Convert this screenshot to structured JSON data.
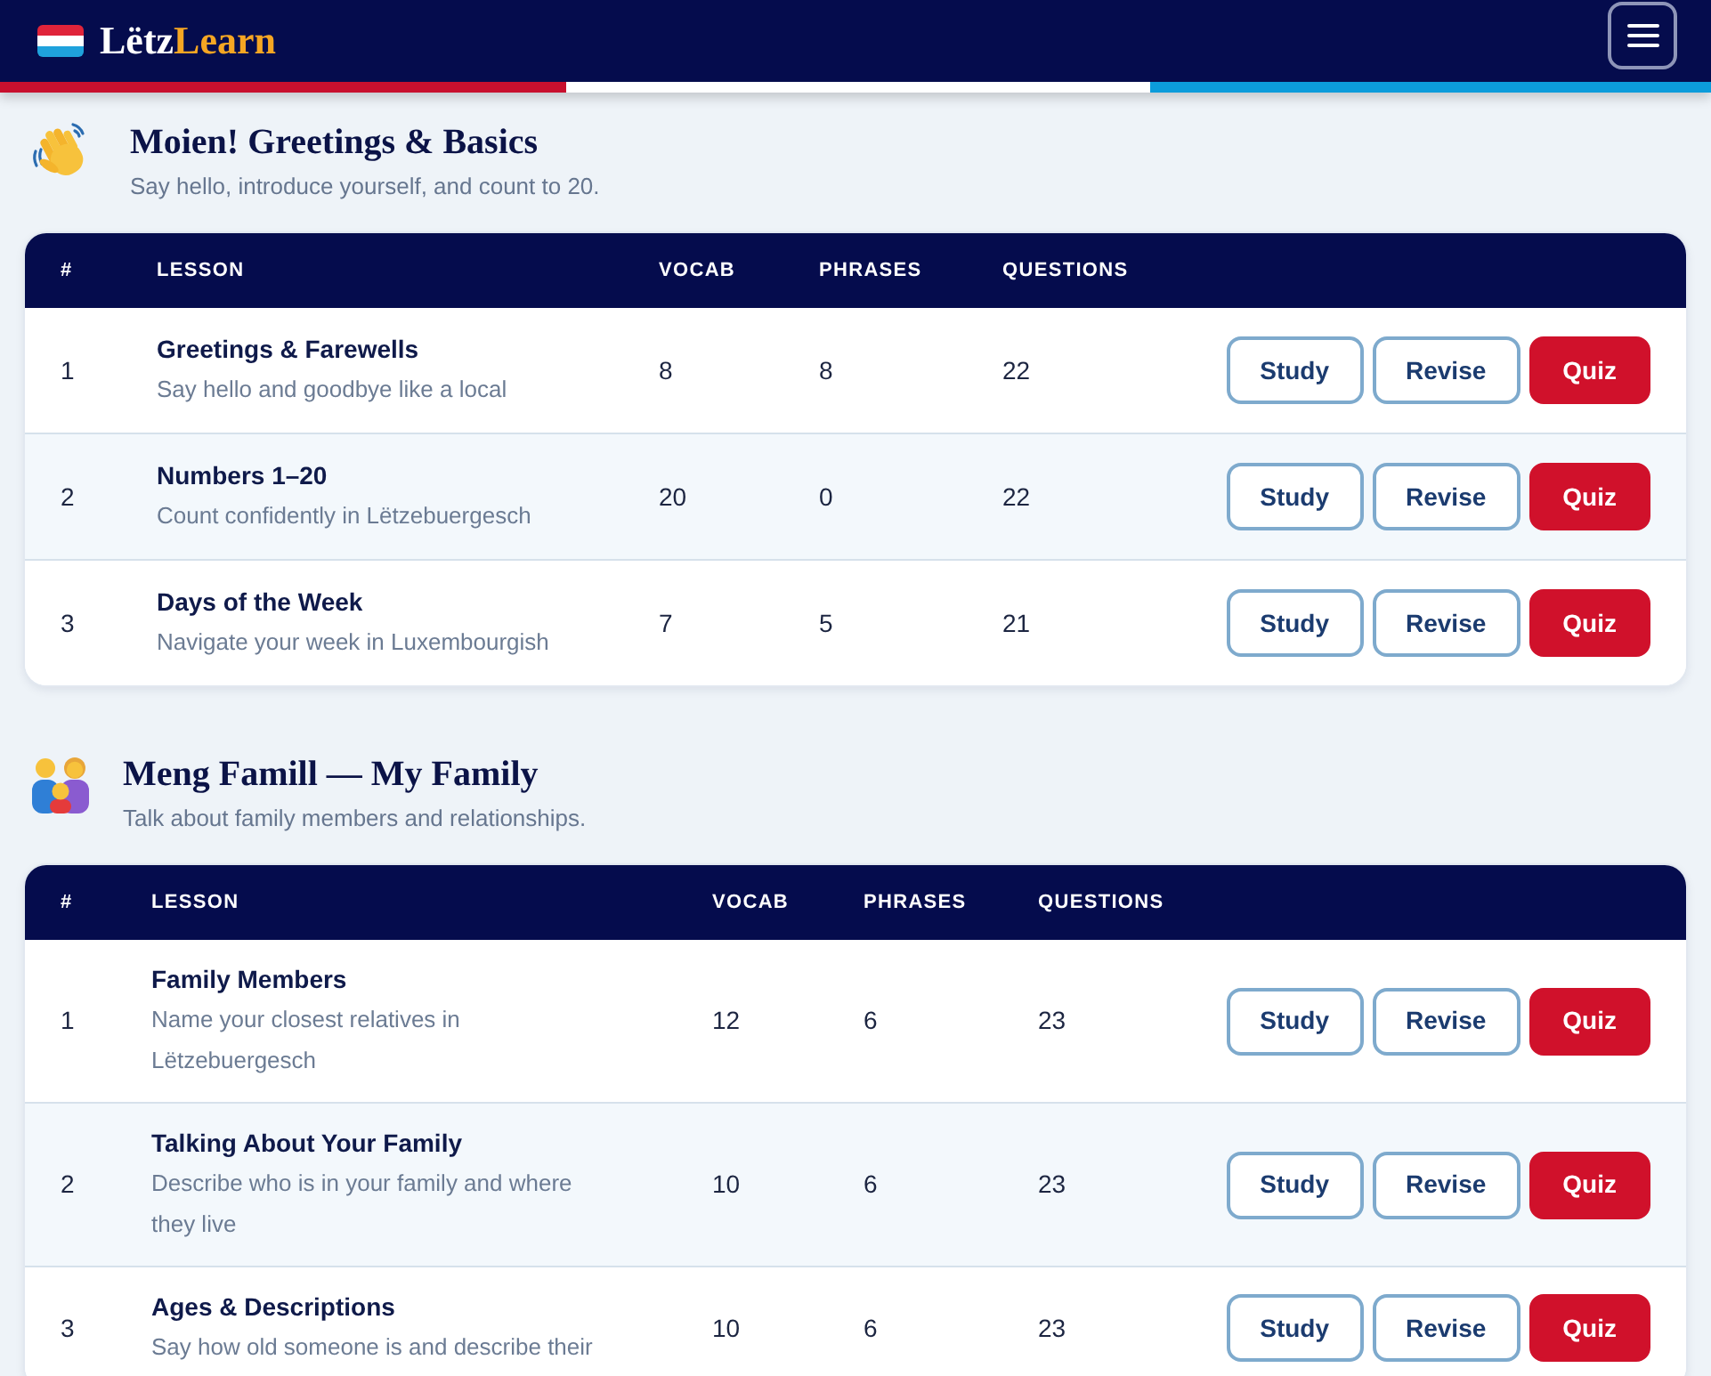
{
  "header": {
    "brand": {
      "text": "Lëtz",
      "accent": "Learn"
    }
  },
  "sections": [
    {
      "title": "Moien! Greetings & Basics",
      "subtitle": "Say hello, introduce yourself, and count to 20.",
      "columns": [
        "#",
        "LESSON",
        "VOCAB",
        "PHRASES",
        "QUESTIONS"
      ],
      "lessons": [
        {
          "number": "1",
          "title": "Greetings & Farewells",
          "description": "Say hello and goodbye like a local",
          "vocab": "8",
          "phrases": "8",
          "questions": "22",
          "actions": [
            {
              "label": "Study",
              "kind": "outline"
            },
            {
              "label": "Revise",
              "kind": "outline"
            },
            {
              "label": "Quiz",
              "kind": "primary"
            }
          ]
        },
        {
          "number": "2",
          "title": "Numbers 1–20",
          "description": "Count confidently in Lëtzebuergesch",
          "vocab": "20",
          "phrases": "0",
          "questions": "22",
          "actions": [
            {
              "label": "Study",
              "kind": "outline"
            },
            {
              "label": "Revise",
              "kind": "outline"
            },
            {
              "label": "Quiz",
              "kind": "primary"
            }
          ]
        },
        {
          "number": "3",
          "title": "Days of the Week",
          "description": "Navigate your week in Luxembourgish",
          "vocab": "7",
          "phrases": "5",
          "questions": "21",
          "actions": [
            {
              "label": "Study",
              "kind": "outline"
            },
            {
              "label": "Revise",
              "kind": "outline"
            },
            {
              "label": "Quiz",
              "kind": "primary"
            }
          ]
        }
      ]
    },
    {
      "title": "Meng Famill — My Family",
      "subtitle": "Talk about family members and relationships.",
      "columns": [
        "#",
        "LESSON",
        "VOCAB",
        "PHRASES",
        "QUESTIONS"
      ],
      "lessons": [
        {
          "number": "1",
          "title": "Family Members",
          "description": "Name your closest relatives in Lëtzebuergesch",
          "vocab": "12",
          "phrases": "6",
          "questions": "23",
          "actions": [
            {
              "label": "Study",
              "kind": "outline"
            },
            {
              "label": "Revise",
              "kind": "outline"
            },
            {
              "label": "Quiz",
              "kind": "primary"
            }
          ]
        },
        {
          "number": "2",
          "title": "Talking About Your Family",
          "description": "Describe who is in your family and where they live",
          "vocab": "10",
          "phrases": "6",
          "questions": "23",
          "actions": [
            {
              "label": "Study",
              "kind": "outline"
            },
            {
              "label": "Revise",
              "kind": "outline"
            },
            {
              "label": "Quiz",
              "kind": "primary"
            }
          ]
        },
        {
          "number": "3",
          "title": "Ages & Descriptions",
          "description": "Say how old someone is and describe their",
          "vocab": "10",
          "phrases": "6",
          "questions": "23",
          "actions": [
            {
              "label": "Study",
              "kind": "outline"
            },
            {
              "label": "Revise",
              "kind": "outline"
            },
            {
              "label": "Quiz",
              "kind": "primary"
            }
          ]
        }
      ]
    }
  ]
}
